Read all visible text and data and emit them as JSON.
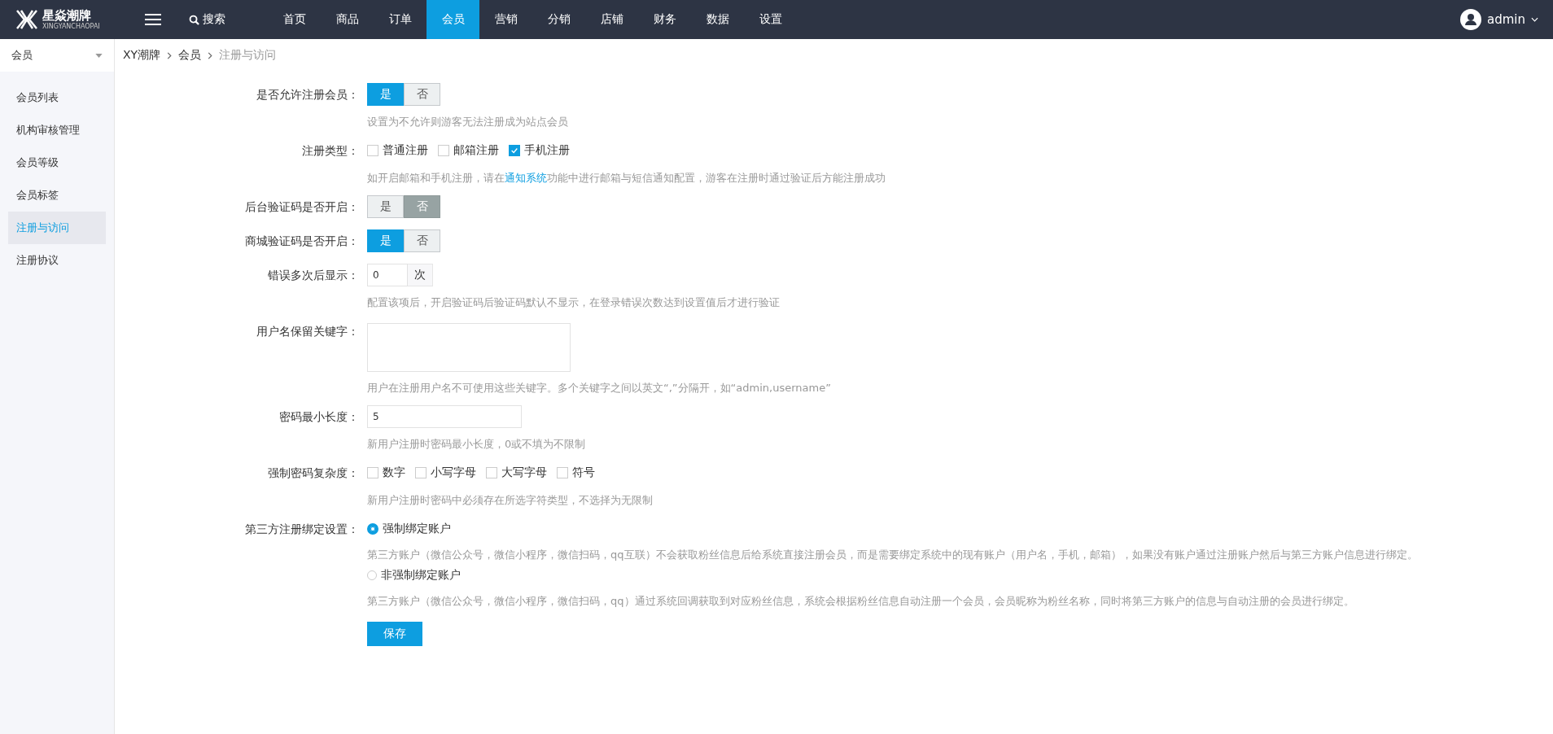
{
  "topbar": {
    "brand": {
      "name": "星焱潮牌",
      "subtitle": "XINGYANCHAOPAI"
    },
    "search": "搜索",
    "nav": [
      {
        "label": "首页",
        "selected": false
      },
      {
        "label": "商品",
        "selected": false
      },
      {
        "label": "订单",
        "selected": false
      },
      {
        "label": "会员",
        "selected": true
      },
      {
        "label": "营销",
        "selected": false
      },
      {
        "label": "分销",
        "selected": false
      },
      {
        "label": "店铺",
        "selected": false
      },
      {
        "label": "财务",
        "selected": false
      },
      {
        "label": "数据",
        "selected": false
      },
      {
        "label": "设置",
        "selected": false
      }
    ],
    "user": "admin"
  },
  "sidebar": {
    "header": "会员",
    "items": [
      {
        "label": "会员列表",
        "selected": false
      },
      {
        "label": "机构审核管理",
        "selected": false
      },
      {
        "label": "会员等级",
        "selected": false
      },
      {
        "label": "会员标签",
        "selected": false
      },
      {
        "label": "注册与访问",
        "selected": true
      },
      {
        "label": "注册协议",
        "selected": false
      }
    ]
  },
  "breadcrumb": [
    "XY潮牌",
    "会员",
    "注册与访问"
  ],
  "form": [
    {
      "kind": "toggle",
      "label": "是否允许注册会员：",
      "options": [
        {
          "label": "是",
          "selected": true
        },
        {
          "label": "否",
          "selected": false
        }
      ],
      "hint": {
        "text": "设置为不允许则游客无法注册成为站点会员"
      }
    },
    {
      "kind": "checkboxes",
      "label": "注册类型：",
      "options": [
        {
          "label": "普通注册",
          "checked": false
        },
        {
          "label": "邮箱注册",
          "checked": false
        },
        {
          "label": "手机注册",
          "checked": true
        }
      ],
      "hint": {
        "text": "如开启邮箱和手机注册，请在",
        "link": "通知系统",
        "after": "功能中进行邮箱与短信通知配置，游客在注册时通过验证后方能注册成功"
      }
    },
    {
      "kind": "toggle",
      "label": "后台验证码是否开启：",
      "options": [
        {
          "label": "是",
          "selected": false
        },
        {
          "label": "否",
          "selected": true
        }
      ]
    },
    {
      "kind": "toggle",
      "label": "商城验证码是否开启：",
      "options": [
        {
          "label": "是",
          "selected": true
        },
        {
          "label": "否",
          "selected": false
        }
      ]
    },
    {
      "kind": "addon",
      "label": "错误多次后显示：",
      "value": "0",
      "addon": "次",
      "hint": {
        "text": "配置该项后，开启验证码后验证码默认不显示，在登录错误次数达到设置值后才进行验证"
      }
    },
    {
      "kind": "textarea",
      "label": "用户名保留关键字：",
      "hint": {
        "text": "用户在注册用户名不可使用这些关键字。多个关键字之间以英文“,”分隔开，如“admin,username”"
      }
    },
    {
      "kind": "input",
      "label": "密码最小长度：",
      "value": "5",
      "hint": {
        "text": "新用户注册时密码最小长度，0或不填为不限制"
      }
    },
    {
      "kind": "checkboxes",
      "label": "强制密码复杂度：",
      "options": [
        {
          "label": "数字",
          "checked": false
        },
        {
          "label": "小写字母",
          "checked": false
        },
        {
          "label": "大写字母",
          "checked": false
        },
        {
          "label": "符号",
          "checked": false
        }
      ],
      "hint": {
        "text": "新用户注册时密码中必须存在所选字符类型，不选择为无限制"
      }
    },
    {
      "kind": "radios",
      "label": "第三方注册绑定设置：",
      "options": [
        {
          "label": "强制绑定账户",
          "selected": true,
          "description": "第三方账户（微信公众号，微信小程序，微信扫码，qq互联）不会获取粉丝信息后给系统直接注册会员，而是需要绑定系统中的现有账户（用户名，手机，邮箱），如果没有账户通过注册账户然后与第三方账户信息进行绑定。"
        },
        {
          "label": "非强制绑定账户",
          "selected": false,
          "description": "第三方账户（微信公众号，微信小程序，微信扫码，qq）通过系统回调获取到对应粉丝信息，系统会根据粉丝信息自动注册一个会员，会员昵称为粉丝名称，同时将第三方账户的信息与自动注册的会员进行绑定。"
        }
      ]
    }
  ],
  "save": "保存"
}
